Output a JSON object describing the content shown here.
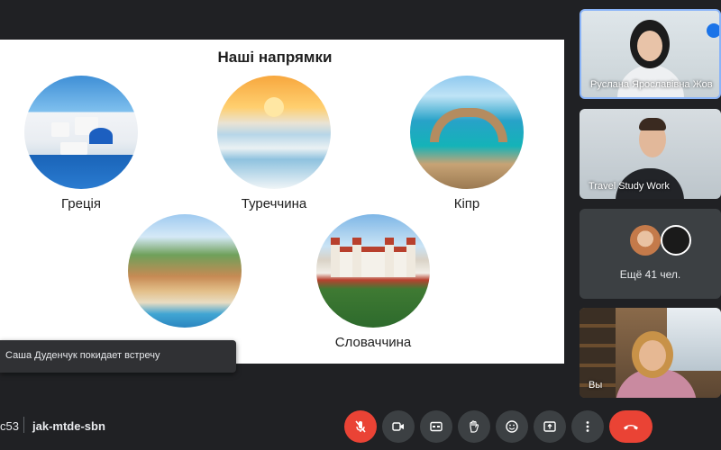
{
  "slide": {
    "title": "Наші напрямки",
    "destinations": [
      {
        "label": "Греція"
      },
      {
        "label": "Туреччина"
      },
      {
        "label": "Кіпр"
      },
      {
        "label": ""
      },
      {
        "label": "Словаччина"
      }
    ]
  },
  "participants": [
    {
      "name": "Руслана Ярославівна Жов"
    },
    {
      "name": "Travel Study Work"
    },
    {
      "name": "Ещё 41 чел."
    },
    {
      "name": "Вы"
    }
  ],
  "toast": {
    "message": "Саша Дуденчук покидает встречу"
  },
  "bottom_bar": {
    "time": "c53",
    "meeting_code": "jak-mtde-sbn"
  },
  "colors": {
    "end_call": "#ea4335",
    "mic_off": "#ea4335",
    "active_speaker": "#8ab4f8",
    "background": "#202124"
  },
  "icons": {
    "mic": "mic-off-icon",
    "camera": "camera-icon",
    "captions": "captions-icon",
    "hand": "raise-hand-icon",
    "emoji": "emoji-icon",
    "present": "present-screen-icon",
    "more": "more-vert-icon",
    "end": "end-call-icon"
  }
}
